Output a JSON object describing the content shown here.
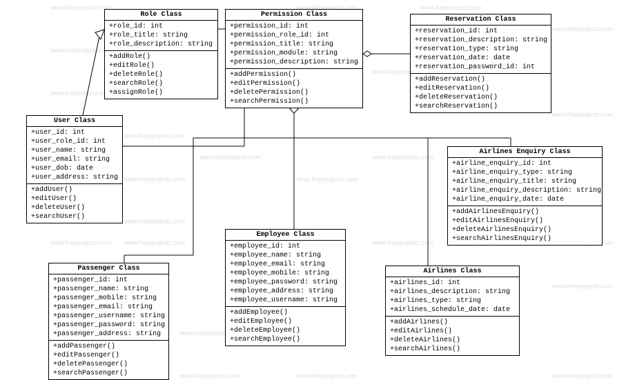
{
  "watermark_text": "www.freeprojectz.com",
  "classes": {
    "role": {
      "title": "Role Class",
      "attrs": [
        "+role_id: int",
        "+role_title: string",
        "+role_description: string"
      ],
      "ops": [
        "+addRole()",
        "+editRole()",
        "+deleteRole()",
        "+searchRole()",
        "+assignRole()"
      ]
    },
    "permission": {
      "title": "Permission Class",
      "attrs": [
        "+permission_id: int",
        "+permission_role_id: int",
        "+permission_title: string",
        "+permission_module: string",
        "+permission_description: string"
      ],
      "ops": [
        "+addPermission()",
        "+editPermission()",
        "+deletePermission()",
        "+searchPermission()"
      ]
    },
    "reservation": {
      "title": "Reservation Class",
      "attrs": [
        "+reservation_id: int",
        "+reservation_description: string",
        "+reservation_type: string",
        "+reservation_date: date",
        "+reservation_password_id: int"
      ],
      "ops": [
        "+addReservation()",
        "+editReservation()",
        "+deleteReservation()",
        "+searchReservation()"
      ]
    },
    "user": {
      "title": "User Class",
      "attrs": [
        "+user_id: int",
        "+user_role_id: int",
        "+user_name: string",
        "+user_email: string",
        "+user_dob: date",
        "+user_address: string"
      ],
      "ops": [
        "+addUser()",
        "+editUser()",
        "+deleteUser()",
        "+searchUser()"
      ]
    },
    "airlines_enquiry": {
      "title": "Airlines Enquiry Class",
      "attrs": [
        "+airline_enquiry_id: int",
        "+airline_enquiry_type: string",
        "+airline_enquiry_title: string",
        "+airline_enquiry_description: string",
        "+airline_enquiry_date: date"
      ],
      "ops": [
        "+addAirlinesEnquiry()",
        "+editAirlinesEnquiry()",
        "+deleteAirlinesEnquiry()",
        "+searchAirlinesEnquiry()"
      ]
    },
    "employee": {
      "title": "Employee Class",
      "attrs": [
        "+employee_id: int",
        "+employee_name: string",
        "+employee_email: string",
        "+employee_mobile: string",
        "+employee_password: string",
        "+employee_address: string",
        "+employee_username: string"
      ],
      "ops": [
        "+addEmployee()",
        "+editEmployee()",
        "+deleteEmployee()",
        "+searchEmployee()"
      ]
    },
    "passenger": {
      "title": "Passenger Class",
      "attrs": [
        "+passenger_id: int",
        "+passenger_name: string",
        "+passenger_mobile: string",
        "+passenger_email: string",
        "+passenger_username: string",
        "+passenger_password: string",
        "+passenger_address: string"
      ],
      "ops": [
        "+addPassenger()",
        "+editPassenger()",
        "+deletePassenger()",
        "+searchPassenger()"
      ]
    },
    "airlines": {
      "title": "Airlines Class",
      "attrs": [
        "+airlines_id: int",
        "+airlines_description: string",
        "+airlines_type: string",
        "+airlines_schedule_date: date"
      ],
      "ops": [
        "+addAirlines()",
        "+editAirlines()",
        "+deleteAirlines()",
        "+searchAirlines()"
      ]
    }
  }
}
